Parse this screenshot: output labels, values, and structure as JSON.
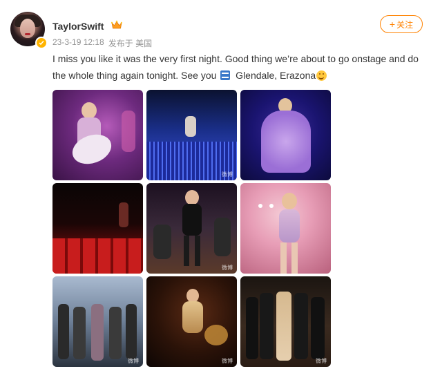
{
  "post": {
    "username": "TaylorSwift",
    "date": "23-3-19 12:18",
    "source": "发布于 美国",
    "text_part1": "I miss you like it was the very first night. Good thing we’re about to go onstage and do the whole thing again tonight. See you ",
    "text_part2": " Glendale, Erazona"
  },
  "follow_button": {
    "label": "关注",
    "icon": "plus-icon"
  },
  "icons": {
    "verified": "verified-badge-icon",
    "crown": "crown-icon",
    "soon_emoji": "soon-arrow-emoji",
    "smile_emoji": "smile-emoji"
  },
  "colors": {
    "accent": "#ff8200",
    "verified": "#ffb400",
    "meta": "#939393"
  },
  "photos": [
    {
      "watermark": ""
    },
    {
      "watermark": "微博"
    },
    {
      "watermark": ""
    },
    {
      "watermark": ""
    },
    {
      "watermark": "微博"
    },
    {
      "watermark": ""
    },
    {
      "watermark": "微博"
    },
    {
      "watermark": "微博"
    },
    {
      "watermark": "微博"
    }
  ]
}
